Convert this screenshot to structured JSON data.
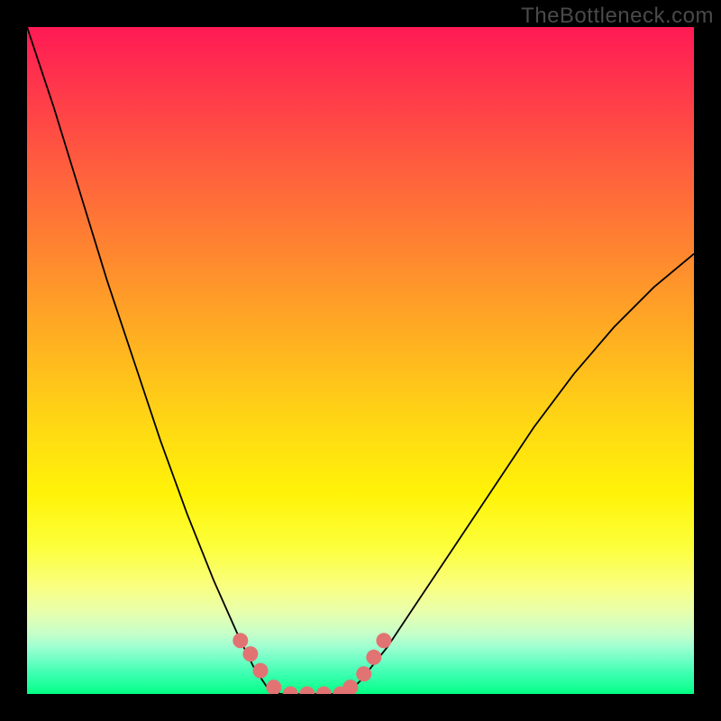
{
  "watermark": "TheBottleneck.com",
  "chart_data": {
    "type": "line",
    "title": "",
    "xlabel": "",
    "ylabel": "",
    "xlim": [
      0,
      100
    ],
    "ylim": [
      0,
      100
    ],
    "grid": false,
    "legend": false,
    "background_gradient": {
      "top_color": "#ff1a55",
      "mid_color": "#ffd913",
      "bottom_color": "#00ff80"
    },
    "series": [
      {
        "name": "bottleneck-curve-left",
        "x": [
          0,
          4,
          8,
          12,
          16,
          20,
          24,
          28,
          32,
          34,
          36,
          38
        ],
        "y": [
          100,
          88,
          75,
          62,
          50,
          38,
          27,
          17,
          8,
          4,
          1,
          0
        ]
      },
      {
        "name": "bottleneck-curve-flat",
        "x": [
          38,
          40,
          42,
          44,
          46,
          48
        ],
        "y": [
          0,
          0,
          0,
          0,
          0,
          0
        ]
      },
      {
        "name": "bottleneck-curve-right",
        "x": [
          48,
          50,
          54,
          58,
          64,
          70,
          76,
          82,
          88,
          94,
          100
        ],
        "y": [
          0,
          2,
          7,
          13,
          22,
          31,
          40,
          48,
          55,
          61,
          66
        ]
      }
    ],
    "markers": {
      "name": "highlight-dots",
      "color": "#e27373",
      "x": [
        32,
        33.5,
        35,
        37,
        39.5,
        42,
        44.5,
        47,
        48.5,
        50.5,
        52,
        53.5
      ],
      "y": [
        8,
        6,
        3.5,
        1,
        0,
        0,
        0,
        0,
        1,
        3,
        5.5,
        8
      ]
    }
  }
}
